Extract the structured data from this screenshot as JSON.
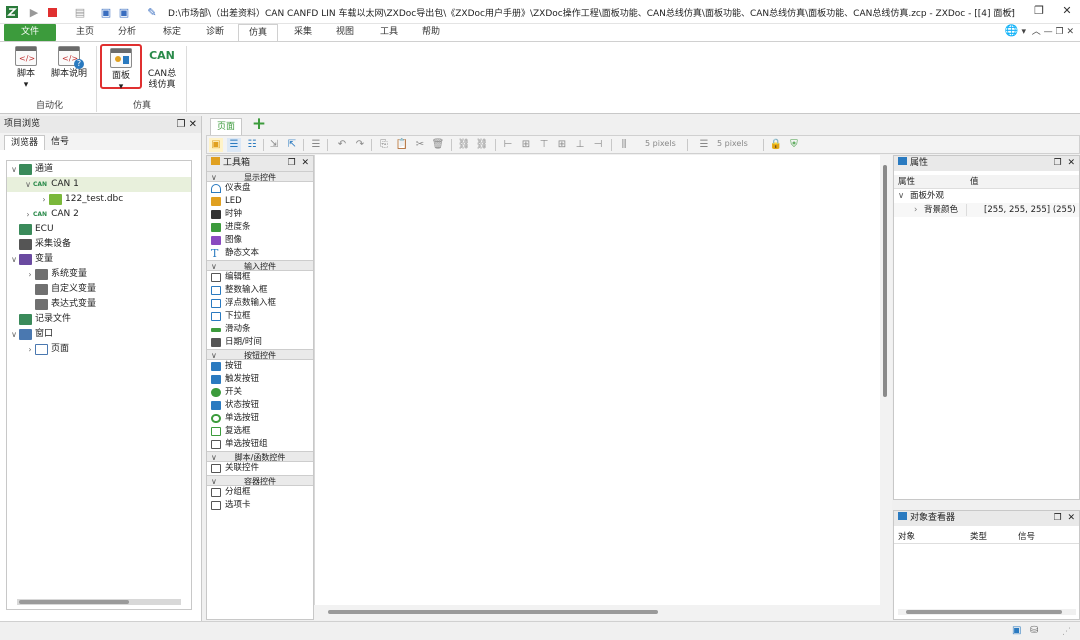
{
  "window": {
    "title": "D:\\市场部\\（出差资料）CAN CANFD LIN 车载以太网\\ZXDoc导出包\\《ZXDoc用户手册》\\ZXDoc操作工程\\面板功能、CAN总线仿真\\面板功能、CAN总线仿真\\面板功能、CAN总线仿真.zcp - ZXDoc - [[4] 面板]"
  },
  "ribbon": {
    "tabs": [
      "文件",
      "主页",
      "分析",
      "标定",
      "诊断",
      "仿真",
      "采集",
      "视图",
      "工具",
      "帮助"
    ],
    "active_tab": "仿真",
    "groups": [
      {
        "label": "自动化",
        "buttons": [
          "脚本",
          "脚本说明"
        ]
      },
      {
        "label": "仿真",
        "buttons": [
          "面板",
          "CAN总\n线仿真"
        ]
      }
    ],
    "can_icon_text": "CAN"
  },
  "project_browser": {
    "title": "项目浏览",
    "tabs": [
      "浏览器",
      "信号"
    ],
    "tree": [
      {
        "label": "通道",
        "level": 0,
        "expanded": true
      },
      {
        "label": "CAN 1",
        "level": 1,
        "expanded": true,
        "selected": true,
        "badge": "CAN"
      },
      {
        "label": "122_test.dbc",
        "level": 2,
        "badge": "DBC"
      },
      {
        "label": "CAN 2",
        "level": 1,
        "badge": "CAN"
      },
      {
        "label": "ECU",
        "level": 0
      },
      {
        "label": "采集设备",
        "level": 0
      },
      {
        "label": "变量",
        "level": 0,
        "expanded": true
      },
      {
        "label": "系统变量",
        "level": 1
      },
      {
        "label": "自定义变量",
        "level": 1
      },
      {
        "label": "表达式变量",
        "level": 1
      },
      {
        "label": "记录文件",
        "level": 0
      },
      {
        "label": "窗口",
        "level": 0,
        "expanded": true
      },
      {
        "label": "页面",
        "level": 1
      }
    ]
  },
  "page_tabs": [
    "页面"
  ],
  "toolbar": {
    "grid_x": "5 pixels",
    "grid_y": "5 pixels"
  },
  "toolbox": {
    "title": "工具箱",
    "categories": [
      {
        "name": "显示控件",
        "items": [
          "仪表盘",
          "LED",
          "时钟",
          "进度条",
          "图像",
          "静态文本"
        ]
      },
      {
        "name": "输入控件",
        "items": [
          "编辑框",
          "整数输入框",
          "浮点数输入框",
          "下拉框",
          "滑动条",
          "日期/时间"
        ]
      },
      {
        "name": "按钮控件",
        "items": [
          "按钮",
          "触发按钮",
          "开关",
          "状态按钮",
          "单选按钮",
          "复选框",
          "单选按钮组"
        ]
      },
      {
        "name": "脚本/函数控件",
        "items": [
          "关联控件"
        ]
      },
      {
        "name": "容器控件",
        "items": [
          "分组框",
          "选项卡"
        ]
      }
    ]
  },
  "properties": {
    "title": "属性",
    "columns": [
      "属性",
      "值"
    ],
    "group": "面板外观",
    "rows": [
      {
        "name": "背景颜色",
        "value": "[255, 255, 255] (255)"
      }
    ]
  },
  "object_viewer": {
    "title": "对象查看器",
    "columns": [
      "对象",
      "类型",
      "信号"
    ]
  },
  "colors": {
    "accent_green": "#3c9b3c",
    "selection_red": "#e03030"
  }
}
